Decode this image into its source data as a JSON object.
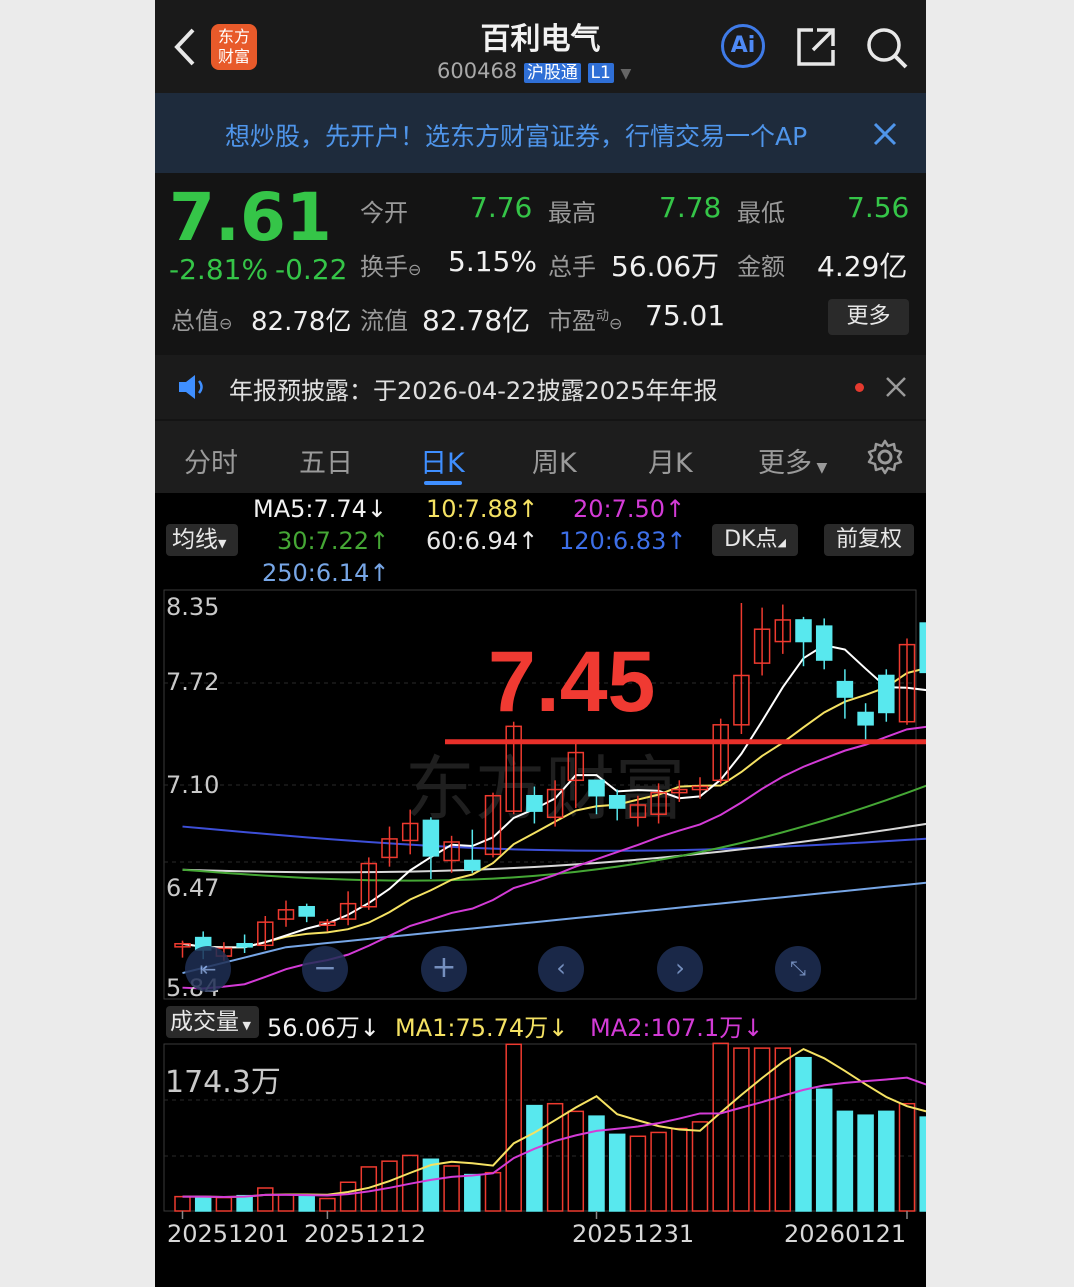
{
  "header": {
    "title": "百利电气",
    "code": "600468",
    "tag_connect": "沪股通",
    "tag_level": "L1",
    "logo_text_1": "东方",
    "logo_text_2": "财富",
    "ai_label": "Ai"
  },
  "banner": {
    "text": "想炒股，先开户！选东方财富证券，行情交易一个AP"
  },
  "quote": {
    "price": "7.61",
    "change_pct": "-2.81%",
    "change": "-0.22",
    "open_label": "今开",
    "open": "7.76",
    "high_label": "最高",
    "high": "7.78",
    "low_label": "最低",
    "low": "7.56",
    "turnover_label": "换手",
    "turnover": "5.15%",
    "volume_label": "总手",
    "volume": "56.06万",
    "amount_label": "金额",
    "amount": "4.29亿",
    "mktcap_label": "总值",
    "mktcap": "82.78亿",
    "float_label": "流值",
    "float": "82.78亿",
    "pe_label": "市盈",
    "pe_sup": "动",
    "pe": "75.01",
    "more_label": "更多"
  },
  "notice": {
    "text": "年报预披露：于2026-04-22披露2025年年报"
  },
  "tabs": [
    "分时",
    "五日",
    "日K",
    "周K",
    "月K",
    "更多"
  ],
  "active_tab": "日K",
  "chart_controls": {
    "ma_select": "均线",
    "dk_button": "DK点",
    "adjust_button": "前复权",
    "ma5": "MA5:7.74↓",
    "ma10": "10:7.88↑",
    "ma20": "20:7.50↑",
    "ma30": "30:7.22↑",
    "ma60": "60:6.94↑",
    "ma120": "120:6.83↑",
    "ma250": "250:6.14↑",
    "annotation": "7.45",
    "watermark": "东方财富"
  },
  "volume_controls": {
    "select": "成交量",
    "current": "56.06万↓",
    "ma1": "MA1:75.74万↓",
    "ma2": "MA2:107.1万↓"
  },
  "colors": {
    "up": "#ee3a2f",
    "down": "#58e8ee",
    "ma5": "#ffffff",
    "ma10": "#f5e263",
    "ma20": "#d33bd6",
    "ma30": "#45a735",
    "ma60": "#d8d8d8",
    "ma120": "#3d4fd8",
    "ma250": "#77a6e6",
    "price_green": "#35c548",
    "accent": "#3f8fff"
  },
  "chart_data": {
    "type": "candlestick",
    "price_axis_ticks": [
      "8.35",
      "7.72",
      "7.10",
      "6.47",
      "5.84"
    ],
    "ylim": [
      5.84,
      8.35
    ],
    "dates_shown": [
      "20251201",
      "20251212",
      "20251231",
      "20260121"
    ],
    "candles": [
      {
        "o": 6.12,
        "c": 6.14,
        "h": 6.16,
        "l": 6.05
      },
      {
        "o": 6.18,
        "c": 6.1,
        "h": 6.22,
        "l": 6.04
      },
      {
        "o": 6.06,
        "c": 6.11,
        "h": 6.15,
        "l": 6.03
      },
      {
        "o": 6.14,
        "c": 6.12,
        "h": 6.2,
        "l": 6.08
      },
      {
        "o": 6.13,
        "c": 6.28,
        "h": 6.32,
        "l": 6.1
      },
      {
        "o": 6.3,
        "c": 6.36,
        "h": 6.42,
        "l": 6.25
      },
      {
        "o": 6.38,
        "c": 6.32,
        "h": 6.4,
        "l": 6.28
      },
      {
        "o": 6.26,
        "c": 6.28,
        "h": 6.3,
        "l": 6.22
      },
      {
        "o": 6.3,
        "c": 6.4,
        "h": 6.48,
        "l": 6.26
      },
      {
        "o": 6.38,
        "c": 6.66,
        "h": 6.7,
        "l": 6.36
      },
      {
        "o": 6.7,
        "c": 6.82,
        "h": 6.9,
        "l": 6.64
      },
      {
        "o": 6.81,
        "c": 6.92,
        "h": 7.01,
        "l": 6.72
      },
      {
        "o": 6.94,
        "c": 6.71,
        "h": 6.96,
        "l": 6.56
      },
      {
        "o": 6.68,
        "c": 6.8,
        "h": 6.84,
        "l": 6.6
      },
      {
        "o": 6.68,
        "c": 6.62,
        "h": 6.88,
        "l": 6.6
      },
      {
        "o": 6.72,
        "c": 7.1,
        "h": 7.12,
        "l": 6.7
      },
      {
        "o": 7.0,
        "c": 7.55,
        "h": 7.58,
        "l": 6.98
      },
      {
        "o": 7.1,
        "c": 7.0,
        "h": 7.16,
        "l": 6.92
      },
      {
        "o": 6.96,
        "c": 7.14,
        "h": 7.2,
        "l": 6.9
      },
      {
        "o": 7.2,
        "c": 7.38,
        "h": 7.46,
        "l": 7.02
      },
      {
        "o": 7.2,
        "c": 7.1,
        "h": 7.18,
        "l": 6.98
      },
      {
        "o": 7.1,
        "c": 7.02,
        "h": 7.14,
        "l": 6.94
      },
      {
        "o": 6.96,
        "c": 7.04,
        "h": 7.1,
        "l": 6.9
      },
      {
        "o": 6.98,
        "c": 7.12,
        "h": 7.18,
        "l": 6.92
      },
      {
        "o": 7.12,
        "c": 7.14,
        "h": 7.2,
        "l": 7.06
      },
      {
        "o": 7.14,
        "c": 7.16,
        "h": 7.22,
        "l": 7.08
      },
      {
        "o": 7.2,
        "c": 7.56,
        "h": 7.6,
        "l": 7.18
      },
      {
        "o": 7.56,
        "c": 7.88,
        "h": 8.35,
        "l": 7.5
      },
      {
        "o": 7.96,
        "c": 8.18,
        "h": 8.32,
        "l": 7.88
      },
      {
        "o": 8.1,
        "c": 8.24,
        "h": 8.34,
        "l": 8.02
      },
      {
        "o": 8.24,
        "c": 8.1,
        "h": 8.26,
        "l": 7.94
      },
      {
        "o": 8.2,
        "c": 7.98,
        "h": 8.25,
        "l": 7.92
      },
      {
        "o": 7.84,
        "c": 7.74,
        "h": 7.92,
        "l": 7.6
      },
      {
        "o": 7.64,
        "c": 7.56,
        "h": 7.7,
        "l": 7.46
      },
      {
        "o": 7.88,
        "c": 7.64,
        "h": 7.92,
        "l": 7.58
      },
      {
        "o": 7.58,
        "c": 8.08,
        "h": 8.12,
        "l": 7.56
      },
      {
        "o": 8.22,
        "c": 7.9,
        "h": 8.26,
        "l": 7.84
      },
      {
        "o": 7.76,
        "c": 7.61,
        "h": 7.78,
        "l": 7.56
      }
    ],
    "volume_axis_label": "174.3万",
    "volume_max": 174.3,
    "volume": [
      15,
      15,
      14,
      16,
      24,
      17,
      15,
      13,
      30,
      46,
      52,
      58,
      54,
      47,
      38,
      40,
      174,
      110,
      112,
      104,
      99,
      80,
      78,
      82,
      86,
      93,
      175,
      170,
      170,
      170,
      160,
      127,
      104,
      100,
      104,
      112,
      98,
      73
    ]
  }
}
